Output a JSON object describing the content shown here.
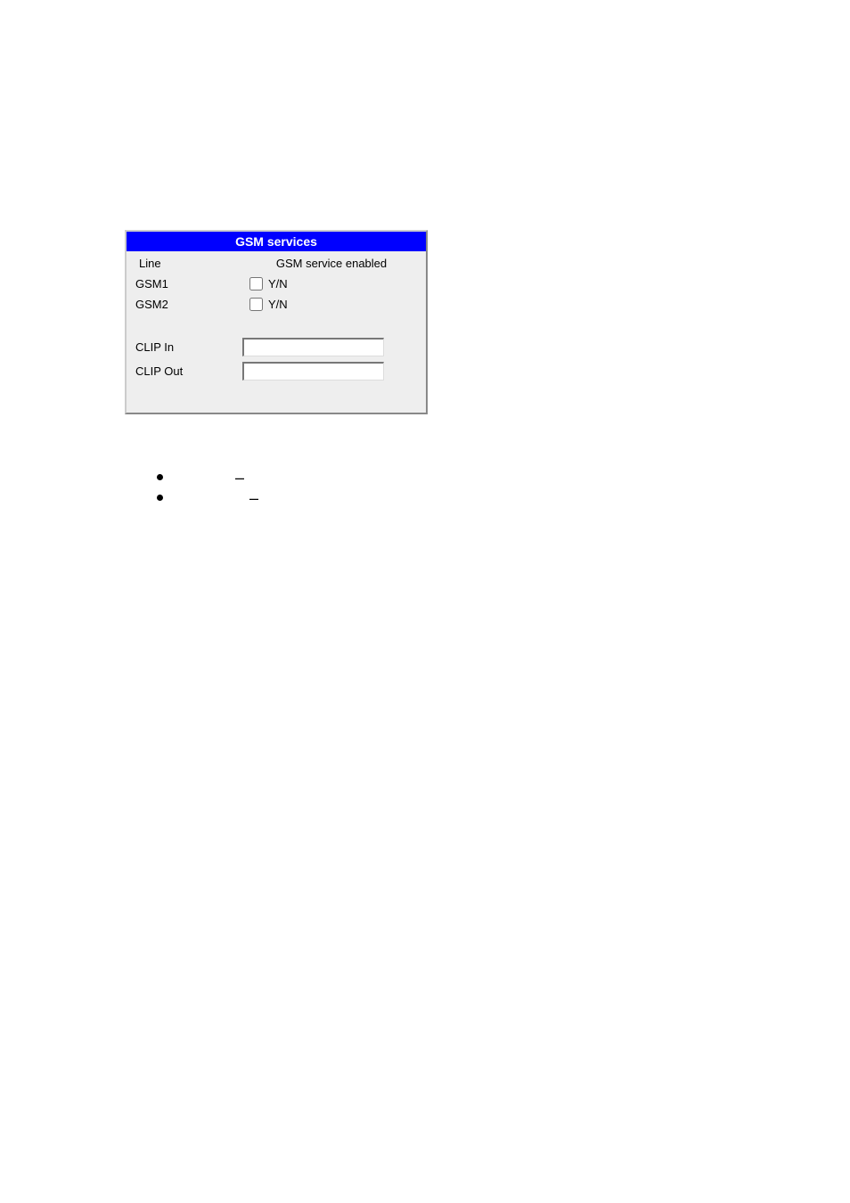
{
  "panel": {
    "title": "GSM services",
    "header_line": "Line",
    "header_service": "GSM service enabled",
    "gsm1_label": "GSM1",
    "gsm1_yn": "Y/N",
    "gsm2_label": "GSM2",
    "gsm2_yn": "Y/N",
    "clip_in_label": "CLIP In",
    "clip_out_label": "CLIP Out",
    "clip_in_value": "",
    "clip_out_value": ""
  },
  "bullets": {
    "b1_dash": "–",
    "b2_dash": "–"
  }
}
